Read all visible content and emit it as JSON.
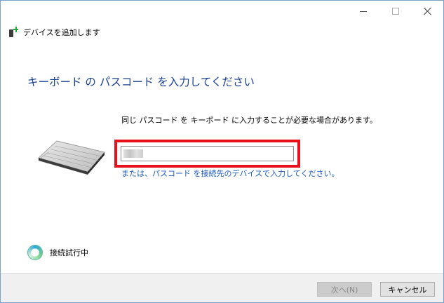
{
  "window": {
    "title_bar_buttons": [
      "minimize",
      "maximize",
      "close"
    ]
  },
  "header": {
    "icon": "add-device-icon",
    "title": "デバイスを追加します"
  },
  "main": {
    "heading": "キーボード の パスコード を入力してください",
    "instruction": "同じ パスコード を キーボード に入力することが必要な場合があります。",
    "passcode_value": "",
    "alt_link": "または、パスコード を接続先のデバイスで入力してください。"
  },
  "status": {
    "text": "接続試行中"
  },
  "footer": {
    "next_label": "次へ(N)",
    "cancel_label": "キャンセル"
  },
  "colors": {
    "heading": "#1a3f93",
    "link": "#1c5ab8",
    "highlight": "#e8101b"
  }
}
